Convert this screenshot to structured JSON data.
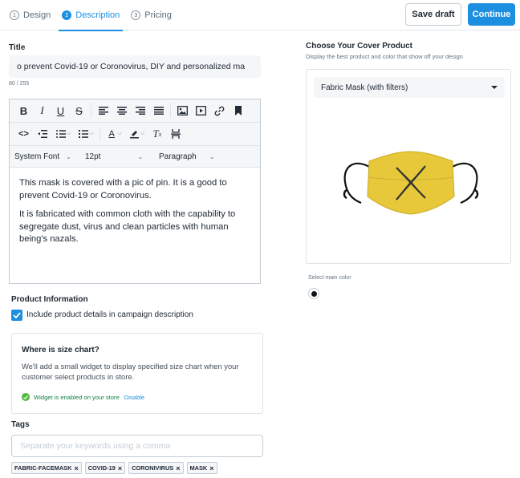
{
  "header": {
    "steps": [
      {
        "num": "1",
        "label": "Design"
      },
      {
        "num": "2",
        "label": "Description"
      },
      {
        "num": "3",
        "label": "Pricing"
      }
    ],
    "save_label": "Save draft",
    "continue_label": "Continue"
  },
  "title": {
    "label": "Title",
    "value": "o prevent Covid-19 or Coronovirus, DIY and personalized ma",
    "count": "80 / 255"
  },
  "editor": {
    "font": "System Font",
    "size": "12pt",
    "block": "Paragraph",
    "paragraphs": [
      "This mask is covered with a pic of pin. It is a good to prevent Covid-19 or Coronovirus.",
      "It is fabricated with common cloth with the capability to segregate dust, virus and clean particles with human being's nazals."
    ]
  },
  "product_info": {
    "label": "Product Information",
    "checkbox_label": "Include product details in campaign description",
    "checked": true
  },
  "size_chart": {
    "title": "Where is size chart?",
    "description": "We'll add a small widget to display specified size chart when your customer select products in store.",
    "status": "Widget is enabled on your store",
    "disable_label": "Disable"
  },
  "tags": {
    "label": "Tags",
    "placeholder": "Separate your keywords using a comma",
    "items": [
      "FABRIC-FACEMASK",
      "COVID-19",
      "CORONIVIRUS",
      "MASK"
    ]
  },
  "cover": {
    "title": "Choose Your Cover Product",
    "subtitle": "Display the best product and color that show off your design",
    "product": "Fabric Mask (with filters)",
    "main_color_label": "Select main color",
    "colors": {
      "accent": "#1d8fe1",
      "mask": "#e7c83b",
      "selected_swatch": "#111111"
    }
  }
}
